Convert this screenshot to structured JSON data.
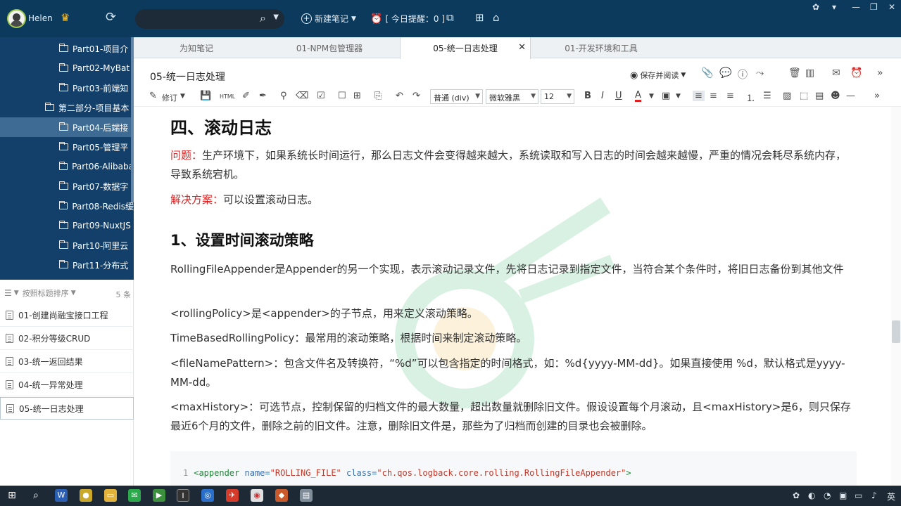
{
  "app": {
    "username": "Helen",
    "search_placeholder": "",
    "new_note": "新建笔记",
    "reminder": "[ 今日提醒：0 ]"
  },
  "sidebar": {
    "tree": [
      {
        "label": "Part01-项目介",
        "indent": 2
      },
      {
        "label": "Part02-MyBat",
        "indent": 2
      },
      {
        "label": "Part03-前端知",
        "indent": 2
      },
      {
        "label": "第二部分-项目基本",
        "indent": 1
      },
      {
        "label": "Part04-后端接",
        "indent": 2,
        "selected": true
      },
      {
        "label": "Part05-管理平",
        "indent": 2
      },
      {
        "label": "Part06-Alibaba",
        "indent": 2
      },
      {
        "label": "Part07-数据字",
        "indent": 2
      },
      {
        "label": "Part08-Redis缓",
        "indent": 2
      },
      {
        "label": "Part09-NuxtJS",
        "indent": 2
      },
      {
        "label": "Part10-阿里云",
        "indent": 2
      },
      {
        "label": "Part11-分布式",
        "indent": 2
      }
    ],
    "sort_label": "按照标题排序",
    "count": "5 条",
    "notes": [
      {
        "label": "01-创建尚融宝接口工程"
      },
      {
        "label": "02-积分等级CRUD"
      },
      {
        "label": "03-统一返回结果"
      },
      {
        "label": "04-统一异常处理"
      },
      {
        "label": "05-统一日志处理",
        "selected": true
      }
    ]
  },
  "tabs": [
    {
      "label": "为知笔记"
    },
    {
      "label": "01-NPM包管理器"
    },
    {
      "label": "05-统一日志处理",
      "active": true
    },
    {
      "label": "01-开发环境和工具"
    }
  ],
  "note": {
    "title": "05-统一日志处理",
    "save_read": "保存并阅读"
  },
  "format": {
    "edit": "修订",
    "html": "HTML",
    "block": "普通 (div)",
    "font": "微软雅黑",
    "size": "12"
  },
  "content": {
    "h2": "四、滚动日志",
    "problem_label": "问题：",
    "problem_text": "生产环境下，如果系统长时间运行，那么日志文件会变得越来越大，系统读取和写入日志的时间会越来越慢，严重的情况会耗尽系统内存，导致系统宕机。",
    "solution_label": "解决方案：",
    "solution_text": "可以设置滚动日志。",
    "h3": "1、设置时间滚动策略",
    "p1": "RollingFileAppender是Appender的另一个实现，表示滚动记录文件，先将日志记录到指定文件，当符合某个条件时，将旧日志备份到其他文件",
    "p2": "<rollingPolicy>是<appender>的子节点，用来定义滚动策略。",
    "p3": "TimeBasedRollingPolicy：最常用的滚动策略，根据时间来制定滚动策略。",
    "p4": "<fileNamePattern>：包含文件名及转换符，“%d”可以包含指定的时间格式，如：%d{yyyy-MM-dd}。如果直接使用 %d，默认格式是yyyy-MM-dd。",
    "p5": "<maxHistory>：可选节点，控制保留的归档文件的最大数量，超出数量就删除旧文件。假设设置每个月滚动，且<maxHistory>是6，则只保存最近6个月的文件，删除之前的旧文件。注意，删除旧文件是，那些为了归档而创建的目录也会被删除。",
    "code": {
      "line_no": "1",
      "open": "<appender",
      "attr1": "name=",
      "val1": "\"ROLLING_FILE\"",
      "attr2": "class=",
      "val2": "\"ch.qos.logback.core.rolling.RollingFileAppender\"",
      "close": ">"
    }
  },
  "taskbar": {
    "lang": "英"
  }
}
